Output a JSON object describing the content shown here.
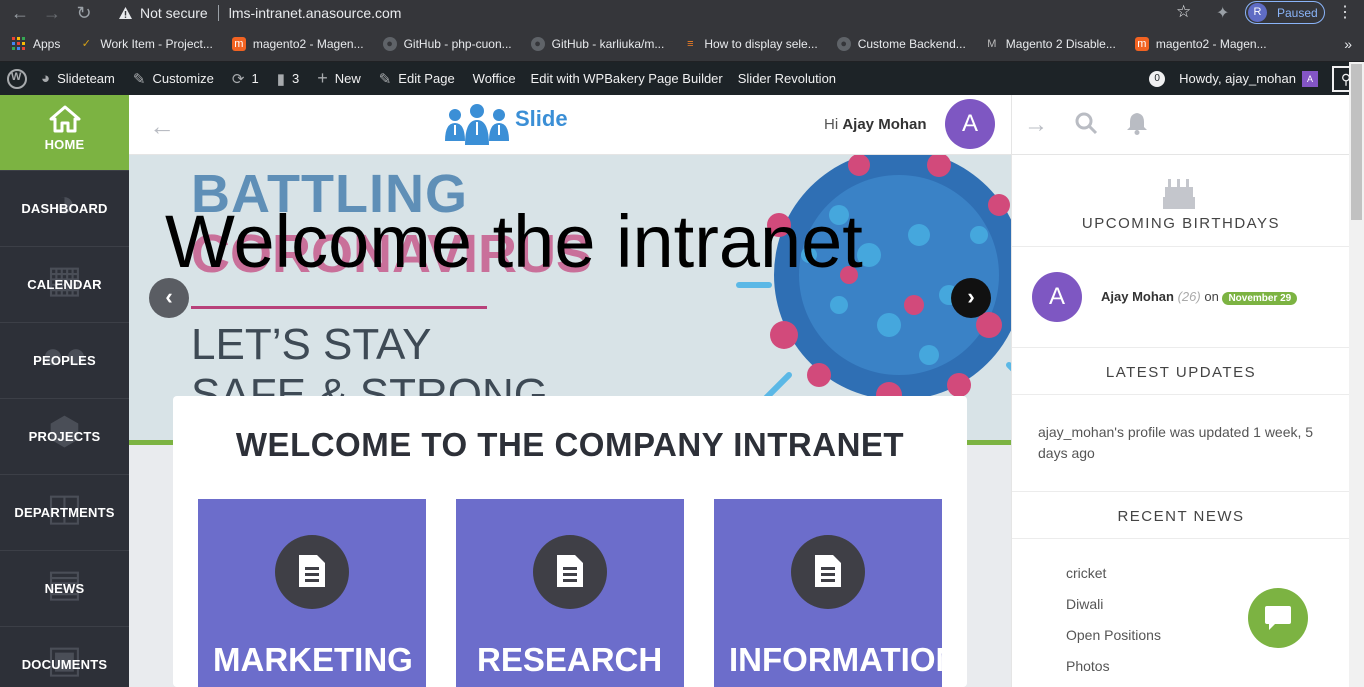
{
  "browser": {
    "security_label": "Not secure",
    "url": "lms-intranet.anasource.com",
    "profile_initial": "R",
    "profile_status": "Paused",
    "bookmarks": [
      {
        "label": "Apps",
        "icon": "apps-grid-icon"
      },
      {
        "label": "Work Item - Project...",
        "icon": "azure-devops-icon"
      },
      {
        "label": "magento2 - Magen...",
        "icon": "magento-icon"
      },
      {
        "label": "GitHub - php-cuon...",
        "icon": "github-icon"
      },
      {
        "label": "GitHub - karliuka/m...",
        "icon": "github-icon"
      },
      {
        "label": "How to display sele...",
        "icon": "stackoverflow-icon"
      },
      {
        "label": "Custome Backend...",
        "icon": "github-icon"
      },
      {
        "label": "Magento 2 Disable...",
        "icon": "m-icon"
      },
      {
        "label": "magento2 - Magen...",
        "icon": "magento-icon"
      }
    ]
  },
  "wp_admin_bar": {
    "site_name": "Slideteam",
    "customize": "Customize",
    "updates_count": "1",
    "comments_count": "3",
    "new_label": "New",
    "edit_page": "Edit Page",
    "woffice": "Woffice",
    "wpbakery": "Edit with WPBakery Page Builder",
    "slider_revolution": "Slider Revolution",
    "notifications_count": "0",
    "howdy": "Howdy, ajay_mohan",
    "avatar_initial": "A"
  },
  "sidebar": {
    "items": [
      {
        "label": "HOME",
        "icon": "home-icon",
        "active": true
      },
      {
        "label": "DASHBOARD",
        "icon": "dashboard-icon"
      },
      {
        "label": "CALENDAR",
        "icon": "calendar-icon"
      },
      {
        "label": "PEOPLES",
        "icon": "users-icon"
      },
      {
        "label": "PROJECTS",
        "icon": "cube-icon"
      },
      {
        "label": "DEPARTMENTS",
        "icon": "sitemap-icon"
      },
      {
        "label": "NEWS",
        "icon": "newspaper-icon"
      },
      {
        "label": "DOCUMENTS",
        "icon": "clipboard-icon"
      }
    ]
  },
  "header": {
    "logo_text": "Slide",
    "greeting": "Hi",
    "user_name": "Ajay Mohan",
    "avatar_initial": "A"
  },
  "banner": {
    "bg_line1": "BATTLING",
    "bg_line2": "CORONAVIRUS",
    "bg_line3": "LET’S STAY",
    "bg_line4": "SAFE & STRONG",
    "headline": "Welcome the intranet"
  },
  "welcome": {
    "title": "WELCOME TO THE COMPANY INTRANET",
    "tiles": [
      {
        "label": "MARKETING"
      },
      {
        "label": "RESEARCH"
      },
      {
        "label": "INFORMATION"
      }
    ]
  },
  "right_panel": {
    "birthdays_title": "UPCOMING BIRTHDAYS",
    "birthday": {
      "avatar_initial": "A",
      "name": "Ajay Mohan",
      "age": "(26)",
      "on": "on",
      "date": "November 29"
    },
    "updates_title": "LATEST UPDATES",
    "update_text": "ajay_mohan's profile was updated 1 week, 5 days ago",
    "news_title": "RECENT NEWS",
    "news": [
      "cricket",
      "Diwali",
      "Open Positions",
      "Photos"
    ]
  },
  "colors": {
    "accent_green": "#7cb342",
    "tile_purple": "#6c6dcb",
    "avatar_purple": "#7e57c2",
    "sidebar_dark": "#2d3038"
  }
}
